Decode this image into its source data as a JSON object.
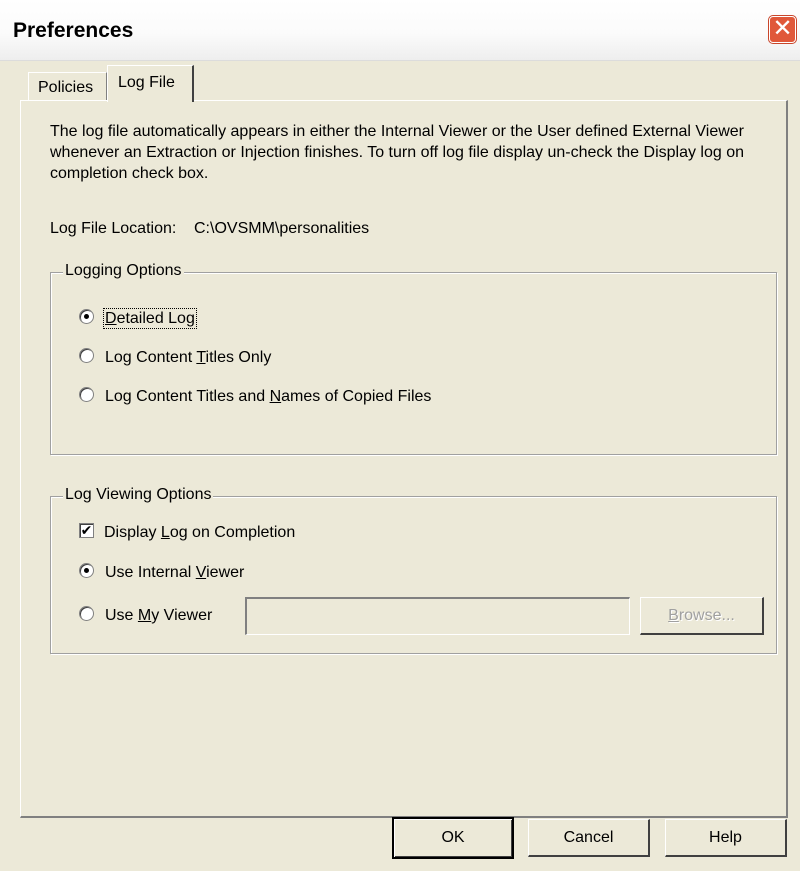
{
  "window": {
    "title": "Preferences",
    "close_glyph": "✕"
  },
  "tabs": [
    {
      "label": "Policies"
    },
    {
      "label": "Log File"
    }
  ],
  "description": "The log file automatically appears in either the Internal Viewer or the User defined External Viewer whenever an Extraction or Injection finishes. To turn off log file display un-check the Display log on completion check box.",
  "log_location": {
    "label": "Log File Location:",
    "value": "C:\\OVSMM\\personalities"
  },
  "logging_options": {
    "legend": "Logging Options",
    "options": [
      {
        "pre": "",
        "mn": "D",
        "post": "etailed Log",
        "selected": true
      },
      {
        "pre": "Log Content ",
        "mn": "T",
        "post": "itles Only",
        "selected": false
      },
      {
        "pre": "Log Content Titles and ",
        "mn": "N",
        "post": "ames of Copied Files",
        "selected": false
      }
    ]
  },
  "viewing_options": {
    "legend": "Log Viewing Options",
    "display_log": {
      "pre": "Display ",
      "mn": "L",
      "post": "og on Completion",
      "checked": true,
      "check_glyph": "✔"
    },
    "internal": {
      "pre": "Use Internal ",
      "mn": "V",
      "post": "iewer",
      "selected": true
    },
    "my_viewer": {
      "pre": "Use ",
      "mn": "M",
      "post": "y Viewer",
      "selected": false,
      "path_value": ""
    },
    "browse": {
      "pre": "",
      "mn": "B",
      "post": "rowse..."
    }
  },
  "footer": {
    "ok": "OK",
    "cancel": "Cancel",
    "help": "Help"
  }
}
